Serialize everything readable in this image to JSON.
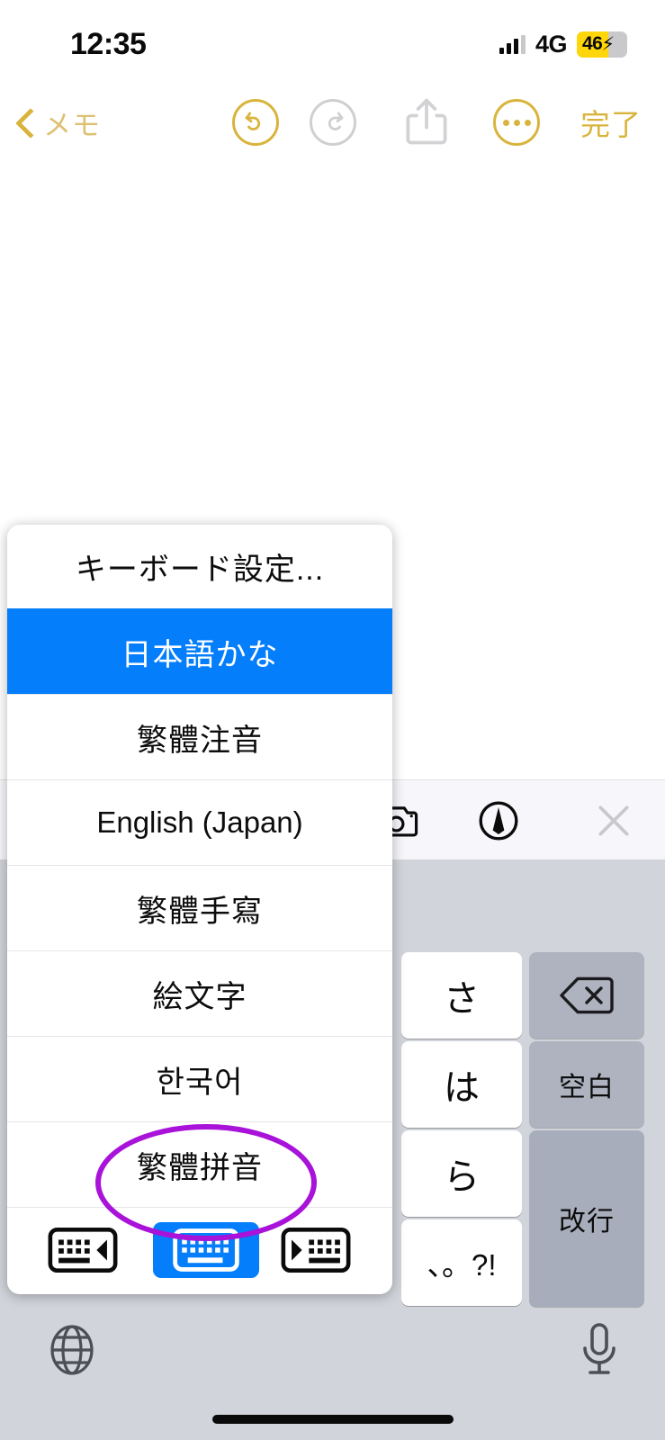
{
  "status_bar": {
    "time": "12:35",
    "network": "4G",
    "battery_percent": "46",
    "battery_charging_glyph": "⚡",
    "battery_level_pct": 46,
    "battery_fill_color": "#ffd60a"
  },
  "navbar": {
    "back_label": "メモ",
    "undo_icon": "undo-icon",
    "redo_icon": "redo-icon",
    "share_icon": "share-icon",
    "more_icon": "more-ellipsis-icon",
    "done_label": "完了",
    "accent_color": "#d9b43c",
    "disabled_color": "#cfcfd2"
  },
  "note": {
    "content": ""
  },
  "keyboard_toolbar": {
    "camera_icon": "camera-icon",
    "markup_icon": "markup-pen-icon",
    "close_icon": "close-x-icon"
  },
  "keyboard_popup": {
    "header_label": "キーボード設定...",
    "selected_color": "#057efb",
    "items": [
      {
        "label": "日本語かな",
        "selected": true
      },
      {
        "label": "繁體注音",
        "selected": false
      },
      {
        "label": "English (Japan)",
        "selected": false,
        "latin": true
      },
      {
        "label": "繁體手寫",
        "selected": false
      },
      {
        "label": "絵文字",
        "selected": false
      },
      {
        "label": "한국어",
        "selected": false
      },
      {
        "label": "繁體拼音",
        "selected": false,
        "annotated": true
      }
    ],
    "layout_buttons": [
      {
        "name": "keyboard-dock-left-icon",
        "active": false
      },
      {
        "name": "keyboard-full-icon",
        "active": true
      },
      {
        "name": "keyboard-dock-right-icon",
        "active": false
      }
    ]
  },
  "annotation": {
    "type": "ellipse-highlight",
    "target_label": "繁體拼音",
    "color": "#a812d9"
  },
  "keyboard": {
    "background_color": "#d1d4da",
    "keys": [
      {
        "label": "さ",
        "style": "white"
      },
      {
        "label": "は",
        "style": "white"
      },
      {
        "label": "ら",
        "style": "white"
      },
      {
        "label": "、。?!",
        "style": "white"
      },
      {
        "label": "delete-icon",
        "style": "gray"
      },
      {
        "label": "空白",
        "style": "gray"
      },
      {
        "label": "改行",
        "style": "gray"
      }
    ],
    "globe_icon": "globe-icon",
    "mic_icon": "microphone-icon"
  }
}
